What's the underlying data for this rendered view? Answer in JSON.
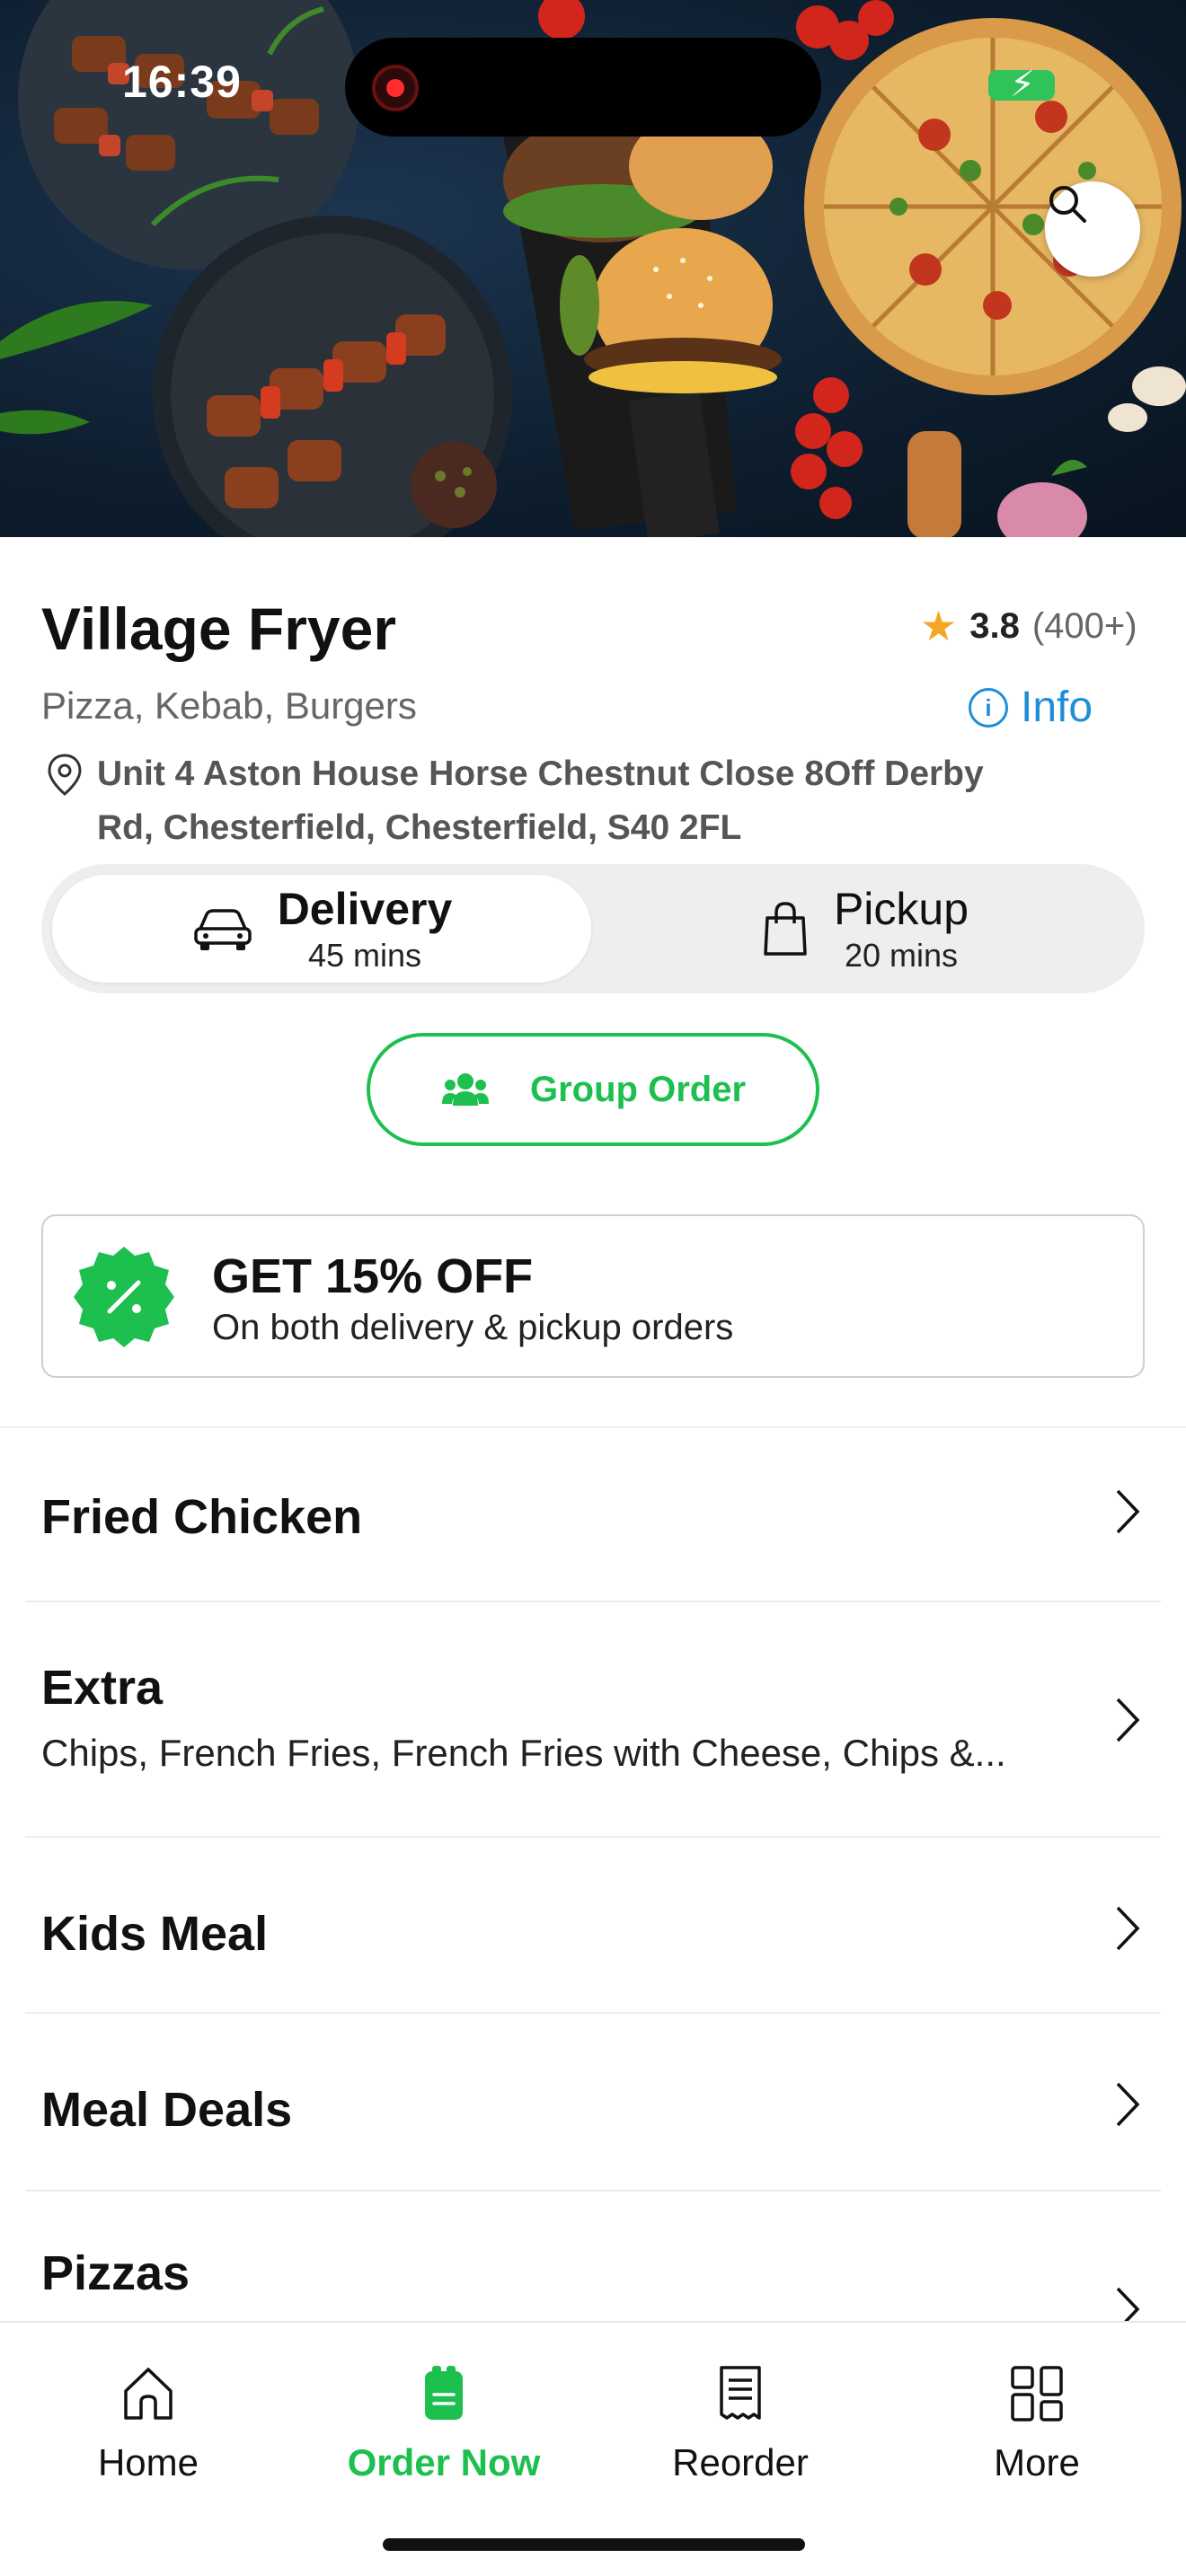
{
  "status_bar": {
    "time": "16:39"
  },
  "restaurant": {
    "name": "Village Fryer",
    "rating": "3.8",
    "rating_count": "(400+)",
    "cuisines": "Pizza, Kebab, Burgers",
    "info_label": "Info",
    "address": "Unit 4 Aston House Horse Chestnut Close 8Off Derby Rd, Chesterfield, Chesterfield, S40 2FL"
  },
  "order_mode": {
    "delivery": {
      "label": "Delivery",
      "time": "45 mins",
      "selected": true
    },
    "pickup": {
      "label": "Pickup",
      "time": "20 mins",
      "selected": false
    }
  },
  "group_order": {
    "label": "Group Order"
  },
  "promo": {
    "title": "GET 15% OFF",
    "subtitle": "On both delivery & pickup orders"
  },
  "categories": [
    {
      "title": "Fried Chicken",
      "desc": ""
    },
    {
      "title": "Extra",
      "desc": "Chips, French Fries, French Fries with Cheese, Chips &..."
    },
    {
      "title": "Kids Meal",
      "desc": ""
    },
    {
      "title": "Meal Deals",
      "desc": ""
    },
    {
      "title": "Pizzas",
      "desc": ""
    }
  ],
  "bottom_nav": [
    {
      "label": "Home",
      "icon": "home-icon",
      "active": false
    },
    {
      "label": "Order Now",
      "icon": "order-icon",
      "active": true
    },
    {
      "label": "Reorder",
      "icon": "receipt-icon",
      "active": false
    },
    {
      "label": "More",
      "icon": "grid-icon",
      "active": false
    }
  ],
  "colors": {
    "accent": "#1dbf4f",
    "link": "#1e8fd6",
    "star": "#f5a623"
  }
}
